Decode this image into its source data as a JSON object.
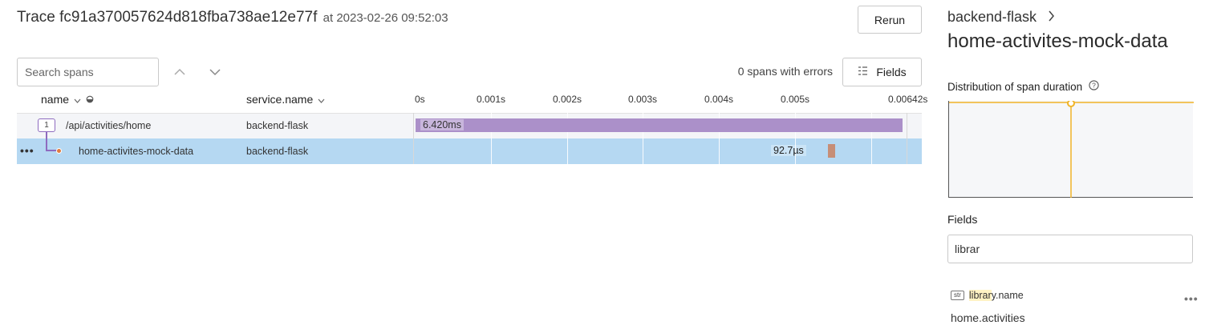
{
  "header": {
    "title_prefix": "Trace fc91a370057624d818fba738ae12e77f",
    "title_suffix": "at 2023-02-26 09:52:03",
    "rerun_label": "Rerun"
  },
  "toolbar": {
    "search_placeholder": "Search spans",
    "errors_text": "0 spans with errors",
    "fields_label": "Fields",
    "icons": [
      "chevron-up-icon",
      "chevron-down-icon",
      "columns-icon"
    ]
  },
  "columns": {
    "name": "name",
    "service": "service.name"
  },
  "timeline_ticks": [
    "0s",
    "0.001s",
    "0.002s",
    "0.003s",
    "0.004s",
    "0.005s",
    "0.00642s"
  ],
  "spans": [
    {
      "badge": "1",
      "name": "/api/activities/home",
      "service": "backend-flask",
      "duration_label": "6.420ms",
      "start_s": 0,
      "duration_s": 0.00642,
      "color": "#ab90c9"
    },
    {
      "name": "home-activites-mock-data",
      "service": "backend-flask",
      "duration_label": "92.7µs",
      "start_s": 0.00543,
      "duration_s": 9.27e-05,
      "color": "#c68e77",
      "selected": true
    }
  ],
  "details": {
    "service": "backend-flask",
    "span_name": "home-activites-mock-data",
    "distribution_label": "Distribution of span duration",
    "fields_label": "Fields",
    "fields_filter_value": "librar",
    "field": {
      "type": "str",
      "name_highlight": "librar",
      "name_rest": "y.name",
      "value": "home.activities"
    }
  },
  "colors": {
    "accent_purple": "#ab90c9",
    "selected_row": "#b5d8f2",
    "child_span": "#c68e77",
    "distribution_line": "#f0b429"
  }
}
